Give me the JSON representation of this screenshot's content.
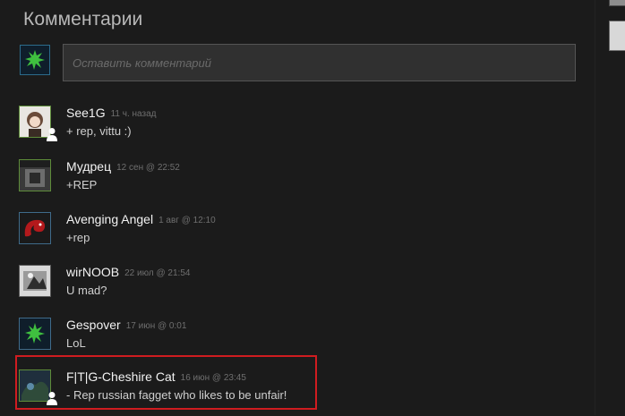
{
  "header": {
    "title": "Комментарии"
  },
  "composer": {
    "placeholder": "Оставить комментарий"
  },
  "comments": [
    {
      "author": "See1G",
      "time": "11 ч. назад",
      "text": "+ rep, vittu :)"
    },
    {
      "author": "Мудрец",
      "time": "12 сен @ 22:52",
      "text": "+REP"
    },
    {
      "author": "Avenging Angel",
      "time": "1 авг @ 12:10",
      "text": "+rep"
    },
    {
      "author": "wirNOOB",
      "time": "22 июл @ 21:54",
      "text": "U mad?"
    },
    {
      "author": "Gespover",
      "time": "17 июн @ 0:01",
      "text": "LoL"
    },
    {
      "author": "F|T|G-Cheshire Cat",
      "time": "16 июн @ 23:45",
      "text": "- Rep russian fagget who likes to be unfair!"
    }
  ],
  "colors": {
    "background": "#1b1b1b",
    "highlight": "#d01c20",
    "timestamp": "#6f6f6f"
  },
  "icons": [
    "razer-avatar-icon",
    "user-icon"
  ]
}
